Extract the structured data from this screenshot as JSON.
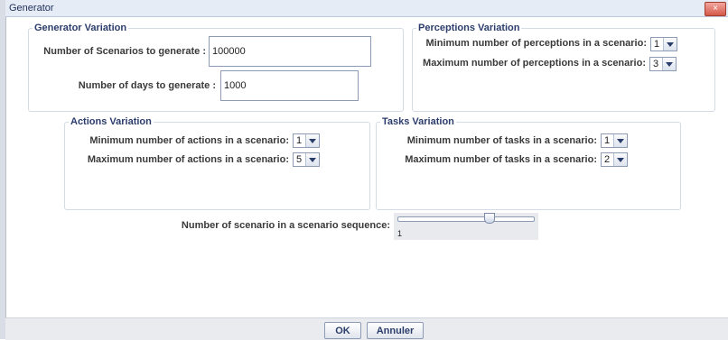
{
  "window": {
    "title": "Generator",
    "close_icon": "×"
  },
  "generator_variation": {
    "legend": "Generator Variation",
    "scenarios_label": "Number of Scenarios to generate :",
    "scenarios_value": "100000",
    "days_label": "Number of days to generate :",
    "days_value": "1000"
  },
  "perceptions_variation": {
    "legend": "Perceptions Variation",
    "min_label": "Minimum number of perceptions in a scenario:",
    "min_value": "1",
    "max_label": "Maximum number of perceptions in a scenario:",
    "max_value": "3"
  },
  "actions_variation": {
    "legend": "Actions Variation",
    "min_label": "Minimum number of actions in a scenario:",
    "min_value": "1",
    "max_label": "Maximum number of actions in a scenario:",
    "max_value": "5"
  },
  "tasks_variation": {
    "legend": "Tasks Variation",
    "min_label": "Minimum number of tasks in a scenario:",
    "min_value": "1",
    "max_label": "Maximum number of tasks in a scenario:",
    "max_value": "2"
  },
  "sequence": {
    "label": "Number of scenario in a scenario sequence:",
    "value": "1",
    "slider_fraction": 0.67
  },
  "buttons": {
    "ok": "OK",
    "cancel": "Annuler"
  },
  "colors": {
    "accent": "#2b3d6b",
    "titlebar": "#e6ecf6",
    "close": "#d4594a"
  }
}
